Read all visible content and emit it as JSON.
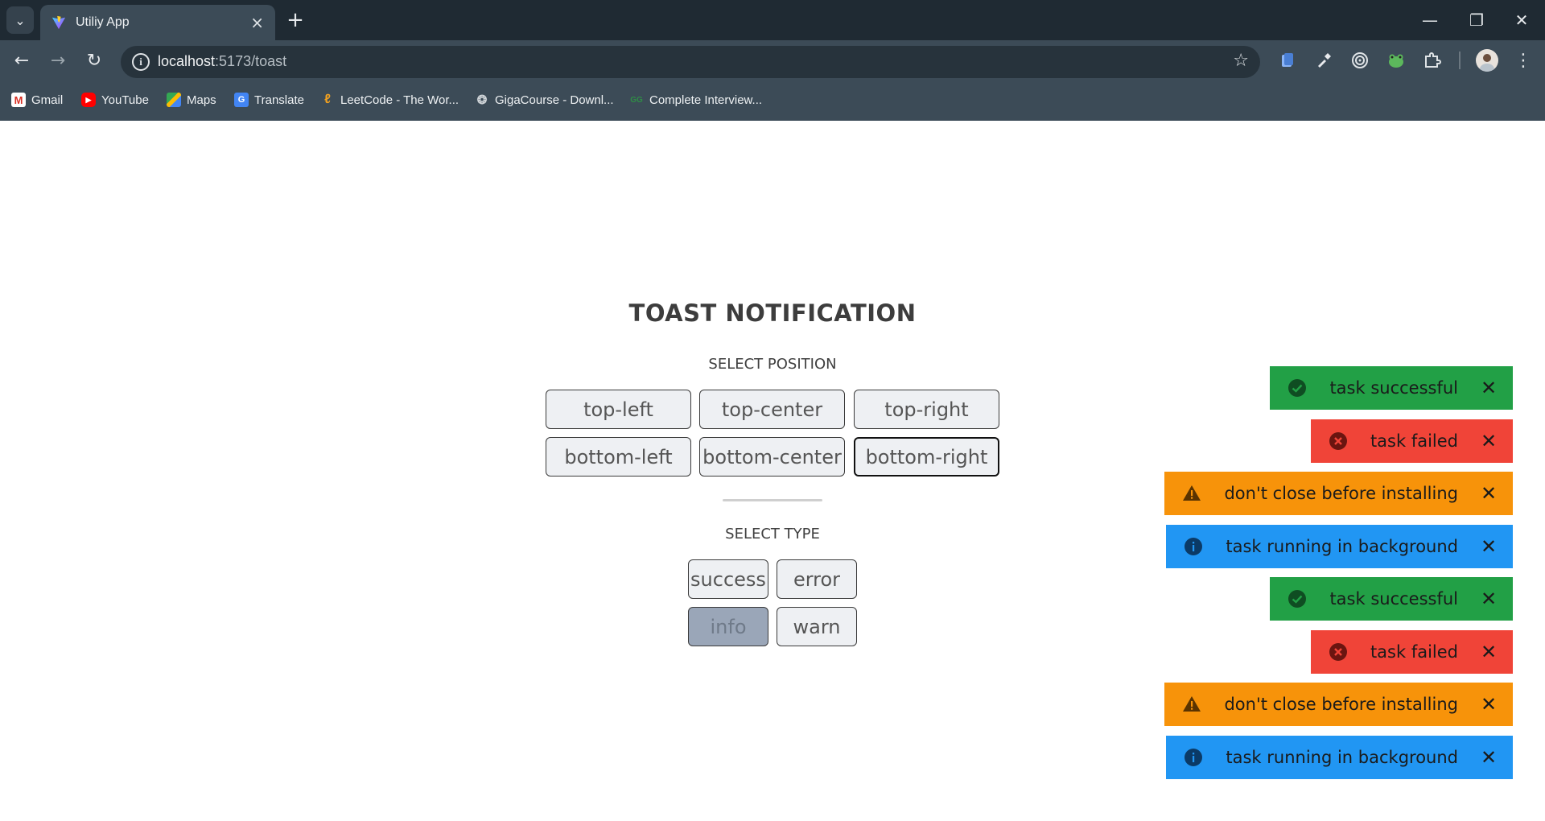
{
  "browser": {
    "tab_title": "Utiliy App",
    "url_host": "localhost",
    "url_rest": ":5173/toast",
    "bookmarks": [
      {
        "label": "Gmail",
        "icon": "gmail-icon",
        "color": "#d93025"
      },
      {
        "label": "YouTube",
        "icon": "youtube-icon",
        "color": "#ff0000"
      },
      {
        "label": "Maps",
        "icon": "maps-icon",
        "color": "#34a853"
      },
      {
        "label": "Translate",
        "icon": "translate-icon",
        "color": "#4285f4"
      },
      {
        "label": "LeetCode - The Wor...",
        "icon": "leetcode-icon",
        "color": "#f0a020"
      },
      {
        "label": "GigaCourse - Downl...",
        "icon": "gigacourse-icon",
        "color": "#9e9e9e"
      },
      {
        "label": "Complete Interview...",
        "icon": "gfg-icon",
        "color": "#2f8d46"
      }
    ]
  },
  "page": {
    "title": "TOAST NOTIFICATION",
    "position_label": "SELECT POSITION",
    "positions": [
      "top-left",
      "top-center",
      "top-right",
      "bottom-left",
      "bottom-center",
      "bottom-right"
    ],
    "selected_position": "bottom-right",
    "type_label": "SELECT TYPE",
    "types": [
      "success",
      "error",
      "info",
      "warn"
    ],
    "selected_type": "info"
  },
  "toasts": [
    {
      "type": "success",
      "message": "task successful",
      "color": "#22a046"
    },
    {
      "type": "error",
      "message": "task failed",
      "color": "#f04438"
    },
    {
      "type": "warn",
      "message": "don't close before installing",
      "color": "#f7930a"
    },
    {
      "type": "info",
      "message": "task running in background",
      "color": "#2196f3"
    },
    {
      "type": "success",
      "message": "task successful",
      "color": "#22a046"
    },
    {
      "type": "error",
      "message": "task failed",
      "color": "#f04438"
    },
    {
      "type": "warn",
      "message": "don't close before installing",
      "color": "#f7930a"
    },
    {
      "type": "info",
      "message": "task running in background",
      "color": "#2196f3"
    }
  ],
  "toast_close_glyph": "✕"
}
